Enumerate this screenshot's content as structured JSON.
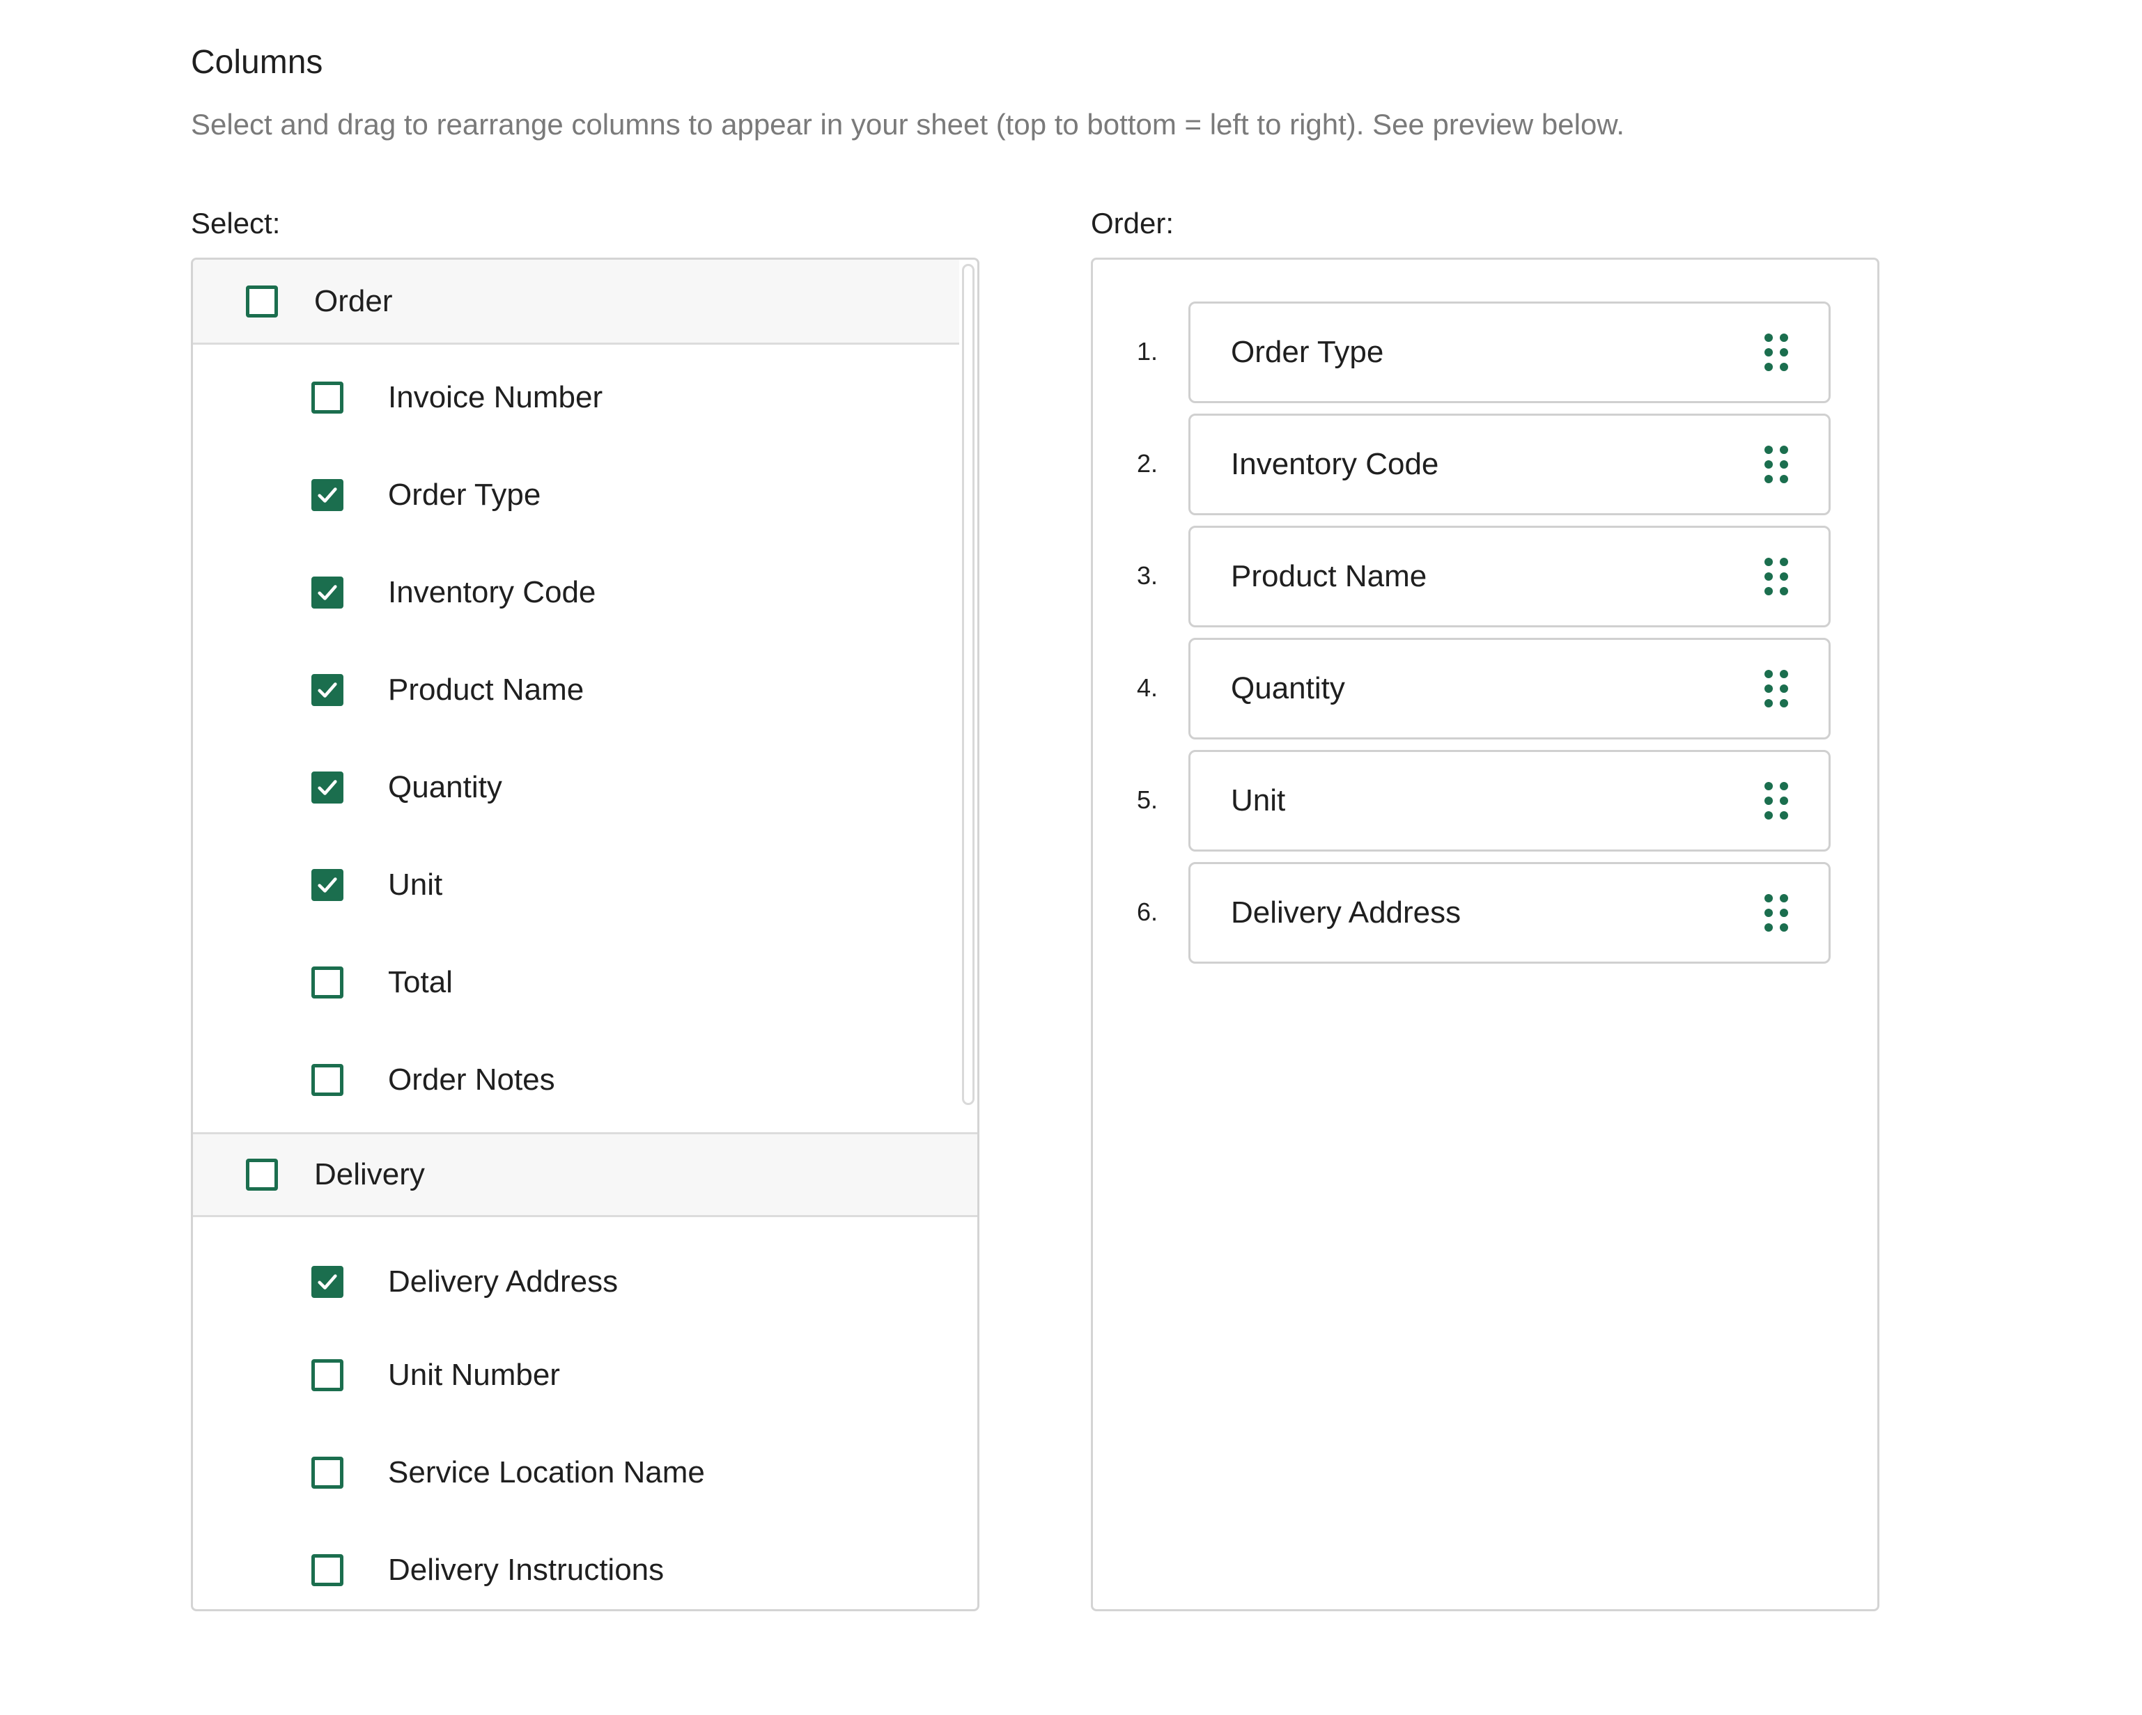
{
  "header": {
    "title": "Columns",
    "subtitle": "Select and drag to rearrange columns to appear in your sheet (top to bottom = left to right). See preview below."
  },
  "select": {
    "label": "Select:",
    "groups": [
      {
        "name": "Order",
        "checked": false,
        "items": [
          {
            "label": "Invoice Number",
            "checked": false
          },
          {
            "label": "Order Type",
            "checked": true
          },
          {
            "label": "Inventory Code",
            "checked": true
          },
          {
            "label": "Product Name",
            "checked": true
          },
          {
            "label": "Quantity",
            "checked": true
          },
          {
            "label": "Unit",
            "checked": true
          },
          {
            "label": "Total",
            "checked": false
          },
          {
            "label": "Order Notes",
            "checked": false
          }
        ]
      },
      {
        "name": "Delivery",
        "checked": false,
        "items": [
          {
            "label": "Delivery Address",
            "checked": true
          },
          {
            "label": "Unit Number",
            "checked": false
          },
          {
            "label": "Service Location Name",
            "checked": false
          },
          {
            "label": "Delivery Instructions",
            "checked": false
          }
        ]
      }
    ]
  },
  "order": {
    "label": "Order:",
    "items": [
      {
        "num": "1.",
        "label": "Order Type"
      },
      {
        "num": "2.",
        "label": "Inventory Code"
      },
      {
        "num": "3.",
        "label": "Product Name"
      },
      {
        "num": "4.",
        "label": "Quantity"
      },
      {
        "num": "5.",
        "label": "Unit"
      },
      {
        "num": "6.",
        "label": "Delivery Address"
      }
    ]
  },
  "icons": {
    "checkbox": "checkbox-icon",
    "checkmark": "checkmark-icon",
    "drag_handle": "drag-handle-icon"
  },
  "colors": {
    "accent": "#1b6e4e",
    "border": "#d4d4d4",
    "header_bg": "#f7f7f7",
    "subtitle": "#7a7a7a"
  }
}
